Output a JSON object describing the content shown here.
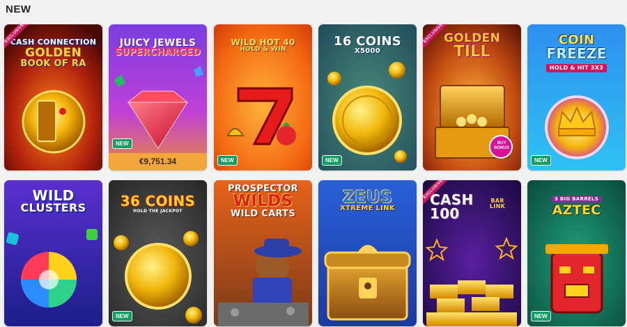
{
  "section": {
    "title": "NEW"
  },
  "badges": {
    "new": "NEW",
    "exclusive": "EXCLUSIVE"
  },
  "games": [
    {
      "title_lines": [
        "CASH CONNECTION",
        "GOLDEN",
        "BOOK OF RA"
      ],
      "exclusive": true,
      "new": false
    },
    {
      "title_lines": [
        "JUICY JEWELS",
        "SUPERCHARGED"
      ],
      "exclusive": false,
      "new": true,
      "jackpot": "€9,751.34"
    },
    {
      "title_lines": [
        "WILD HOT 40",
        "HOLD & WIN"
      ],
      "exclusive": false,
      "new": true
    },
    {
      "title_lines": [
        "16 COINS",
        "x5000"
      ],
      "exclusive": false,
      "new": true
    },
    {
      "title_lines": [
        "GOLDEN",
        "TILL"
      ],
      "exclusive": true,
      "new": false,
      "tag": "BUY BONUS"
    },
    {
      "title_lines": [
        "COIN",
        "FREEZE",
        "HOLD & HIT 3x3"
      ],
      "exclusive": false,
      "new": true
    },
    {
      "title_lines": [
        "WILD",
        "CLUSTERS"
      ],
      "exclusive": false,
      "new": false
    },
    {
      "title_lines": [
        "36 COINS",
        "HOLD THE JACKPOT"
      ],
      "exclusive": false,
      "new": true
    },
    {
      "title_lines": [
        "PROSPECTOR",
        "WILDS",
        "WILD CARTS"
      ],
      "exclusive": false,
      "new": false
    },
    {
      "title_lines": [
        "ZEUS",
        "XTREME LINK"
      ],
      "exclusive": false,
      "new": false
    },
    {
      "title_lines": [
        "CASH",
        "100",
        "BAR LINK"
      ],
      "exclusive": true,
      "new": false
    },
    {
      "title_lines": [
        "3 BIG BARRELS",
        "AZTEC"
      ],
      "exclusive": false,
      "new": true
    }
  ]
}
